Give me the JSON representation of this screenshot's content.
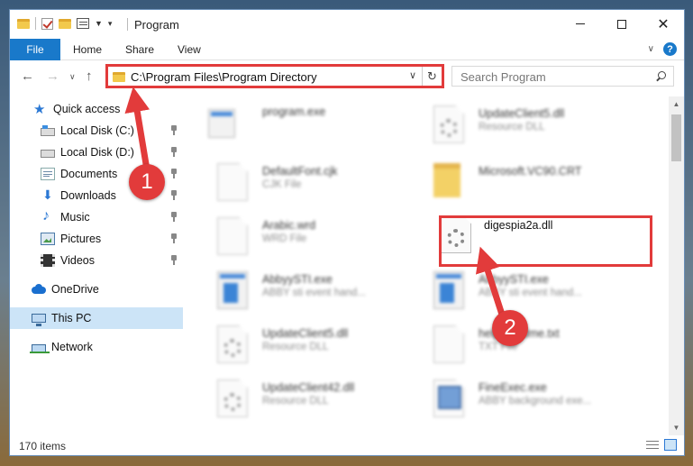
{
  "window": {
    "title": "Program"
  },
  "ribbon": {
    "tabs": [
      "File",
      "Home",
      "Share",
      "View"
    ]
  },
  "address": {
    "path": "C:\\Program Files\\Program Directory"
  },
  "search": {
    "placeholder": "Search Program"
  },
  "sidebar": {
    "items": [
      {
        "label": "Quick access",
        "icon": "star-icon"
      },
      {
        "label": "Local Disk (C:)",
        "icon": "drive-icon",
        "pinned": true
      },
      {
        "label": "Local Disk (D:)",
        "icon": "drive-icon",
        "pinned": true
      },
      {
        "label": "Documents",
        "icon": "documents-icon",
        "pinned": true
      },
      {
        "label": "Downloads",
        "icon": "download-icon",
        "pinned": true
      },
      {
        "label": "Music",
        "icon": "music-icon",
        "pinned": true
      },
      {
        "label": "Pictures",
        "icon": "pictures-icon",
        "pinned": true
      },
      {
        "label": "Videos",
        "icon": "videos-icon",
        "pinned": true
      },
      {
        "label": "OneDrive",
        "icon": "cloud-icon"
      },
      {
        "label": "This PC",
        "icon": "computer-icon",
        "selected": true
      },
      {
        "label": "Network",
        "icon": "network-icon"
      }
    ]
  },
  "files": [
    {
      "name": "program.exe",
      "type": "",
      "icon": "exe-icon"
    },
    {
      "name": "UpdateClient5.dll",
      "type": "Resource DLL",
      "icon": "dll-icon"
    },
    {
      "name": "DefaultFont.cjk",
      "type": "CJK File",
      "icon": "file-icon"
    },
    {
      "name": "Microsoft.VC90.CRT",
      "type": "",
      "icon": "folder-icon"
    },
    {
      "name": "Arabic.wrd",
      "type": "WRD File",
      "icon": "file-icon"
    },
    {
      "name": "digespia2a.dll",
      "type": "",
      "icon": "dll-icon"
    },
    {
      "name": "AbbyySTI.exe",
      "type": "ABBY sti event hand...",
      "icon": "exe-icon"
    },
    {
      "name": "AbbyySTI.exe",
      "type": "ABBY sti event hand...",
      "icon": "exe-icon"
    },
    {
      "name": "UpdateClient5.dll",
      "type": "Resource DLL",
      "icon": "dll-icon"
    },
    {
      "name": "help_readme.txt",
      "type": "TXT File",
      "icon": "file-icon"
    },
    {
      "name": "UpdateClient42.dll",
      "type": "Resource DLL",
      "icon": "dll-icon"
    },
    {
      "name": "FineExec.exe",
      "type": "ABBY background exe...",
      "icon": "exe-icon"
    }
  ],
  "status": {
    "items": "170 items"
  },
  "callouts": [
    "1",
    "2"
  ],
  "colors": {
    "accent": "#1979ca",
    "highlight": "#e23b3b",
    "selected": "#cce4f7"
  }
}
